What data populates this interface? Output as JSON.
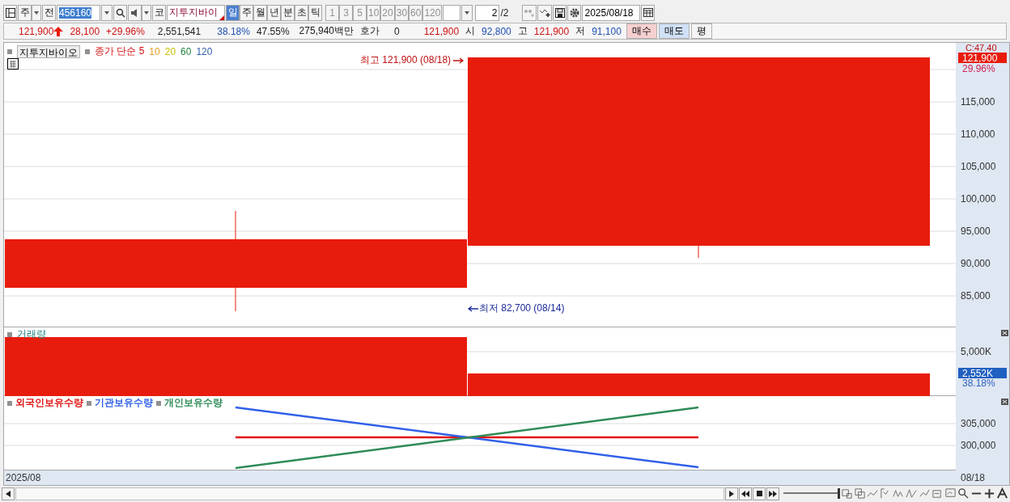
{
  "toolbar": {
    "market": "주",
    "all_button": "전",
    "code": "456160",
    "code_button": "코",
    "name": "지투지바이",
    "periods": [
      {
        "label": "일",
        "selected": true
      },
      {
        "label": "주",
        "selected": false
      },
      {
        "label": "월",
        "selected": false
      },
      {
        "label": "년",
        "selected": false
      },
      {
        "label": "분",
        "selected": false
      },
      {
        "label": "초",
        "selected": false
      },
      {
        "label": "틱",
        "selected": false
      }
    ],
    "intervals": [
      "1",
      "3",
      "5",
      "10",
      "20",
      "30",
      "60",
      "120"
    ],
    "page": "2",
    "page_total": "/2",
    "date": "2025/08/18"
  },
  "quote": {
    "price": "121,900",
    "change": "28,100",
    "change_pct": "+29.96%",
    "volume": "2,551,541",
    "turnover": "38.18%",
    "ratio": "47.55%",
    "amount": "275,940백만",
    "bid_label": "호가",
    "bid_value": "0",
    "bid_price": "121,900",
    "open_label": "시",
    "open": "92,800",
    "high_label": "고",
    "high": "121,900",
    "low_label": "저",
    "low": "91,100",
    "buttons": [
      {
        "label": "매수",
        "kind": "buy"
      },
      {
        "label": "매도",
        "kind": "sell"
      },
      {
        "label": "평",
        "kind": "plain"
      }
    ]
  },
  "price_pane": {
    "stock_label": "지투지바이오",
    "ma_label": "종가 단순 5",
    "legend": [
      {
        "label": "10",
        "color": "#e0a020"
      },
      {
        "label": "20",
        "color": "#c8c000"
      },
      {
        "label": "60",
        "color": "#208040"
      },
      {
        "label": "120",
        "color": "#3060b0"
      }
    ],
    "axis_header": "C:47.40",
    "last_price": "121,900",
    "last_pct": "29.96%",
    "axis_labels": [
      "115,000",
      "110,000",
      "105,000",
      "100,000",
      "95,000",
      "90,000",
      "85,000"
    ],
    "high_note": "최고 121,900 (08/18)",
    "low_note": "최저 82,700 (08/14)"
  },
  "volume_pane": {
    "title": "거래량",
    "axis_labels": [
      "5,000K"
    ],
    "last_volume": "2,552K",
    "last_pct": "38.18%"
  },
  "holdings_pane": {
    "legend": [
      {
        "label": "외국인보유수량",
        "color": "#e01010"
      },
      {
        "label": "기관보유수량",
        "color": "#3060e8"
      },
      {
        "label": "개인보유수량",
        "color": "#2e8b57"
      }
    ],
    "axis_labels": [
      "305,000",
      "300,000"
    ]
  },
  "date_axis": {
    "start": "2025/08",
    "end": "08/18"
  },
  "scrollbar": {
    "zoom": {
      "level": 1
    }
  }
}
